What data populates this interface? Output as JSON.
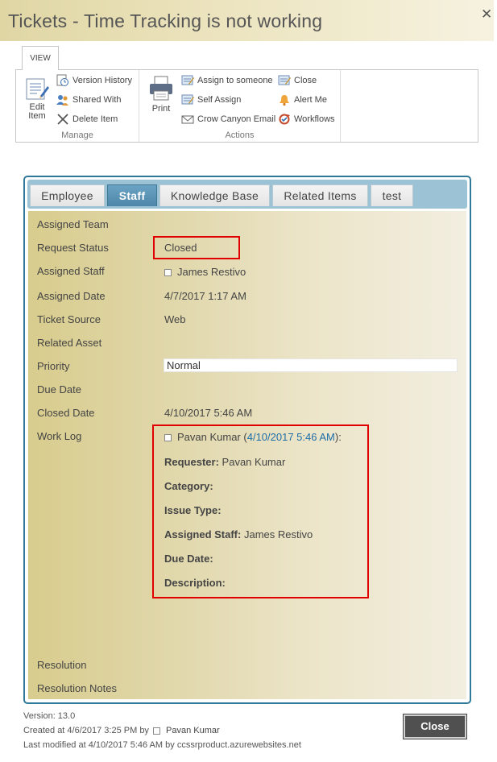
{
  "window": {
    "title": "Tickets - Time Tracking is not working",
    "close_glyph": "✕"
  },
  "ribbon": {
    "tab_label": "VIEW",
    "manage": {
      "label": "Manage",
      "edit_item": {
        "line1": "Edit",
        "line2": "Item"
      },
      "version_history": "Version History",
      "shared_with": "Shared With",
      "delete_item": "Delete Item"
    },
    "actions": {
      "label": "Actions",
      "print": "Print",
      "assign_to_someone": "Assign to someone",
      "self_assign": "Self Assign",
      "crow_canyon_email": "Crow Canyon Email",
      "close": "Close",
      "alert_me": "Alert Me",
      "workflows": "Workflows"
    }
  },
  "tabs": [
    "Employee",
    "Staff",
    "Knowledge Base",
    "Related Items",
    "test"
  ],
  "active_tab": "Staff",
  "fields": {
    "assigned_team": {
      "label": "Assigned Team",
      "value": ""
    },
    "request_status": {
      "label": "Request Status",
      "value": "Closed"
    },
    "assigned_staff": {
      "label": "Assigned Staff",
      "value": "James Restivo"
    },
    "assigned_date": {
      "label": "Assigned Date",
      "value": "4/7/2017 1:17 AM"
    },
    "ticket_source": {
      "label": "Ticket Source",
      "value": "Web"
    },
    "related_asset": {
      "label": "Related Asset",
      "value": ""
    },
    "priority": {
      "label": "Priority",
      "value": "Normal"
    },
    "due_date": {
      "label": "Due Date",
      "value": ""
    },
    "closed_date": {
      "label": "Closed Date",
      "value": "4/10/2017 5:46 AM"
    },
    "work_log": {
      "label": "Work Log"
    },
    "resolution": {
      "label": "Resolution",
      "value": ""
    },
    "resolution_notes": {
      "label": "Resolution Notes",
      "value": ""
    }
  },
  "work_log": {
    "author": "Pavan Kumar",
    "open_paren": "(",
    "timestamp": "4/10/2017 5:46 AM",
    "close_paren": "):",
    "requester_label": "Requester:",
    "requester_value": "Pavan Kumar",
    "category_label": "Category:",
    "issue_type_label": "Issue Type:",
    "assigned_staff_label": "Assigned Staff:",
    "assigned_staff_value": "James Restivo",
    "due_date_label": "Due Date:",
    "description_label": "Description:"
  },
  "footer": {
    "version": "Version: 13.0",
    "created_prefix": "Created at 4/6/2017 3:25 PM  by",
    "created_by": "Pavan Kumar",
    "modified_prefix": "Last modified at 4/10/2017 5:46 AM  by",
    "modified_by": "ccssrproduct.azurewebsites.net",
    "close_button": "Close"
  },
  "colors": {
    "tab_active": "#4d86a8",
    "tab_strip": "#9cc3d5",
    "panel_border": "#2f7a9a",
    "highlight_box": "#e00000",
    "link": "#1e6ea9"
  }
}
